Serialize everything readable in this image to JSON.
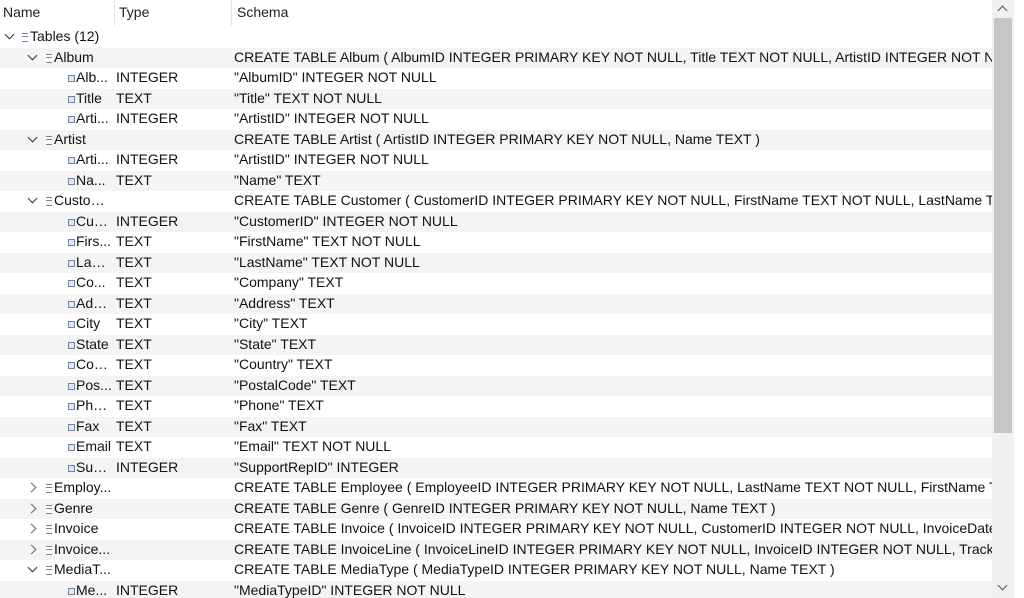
{
  "columns": {
    "name": "Name",
    "type": "Type",
    "schema": "Schema"
  },
  "rows": [
    {
      "depth": 0,
      "kind": "folder",
      "expanded": true,
      "name": "Tables (12)",
      "type": "",
      "schema": ""
    },
    {
      "depth": 1,
      "kind": "table",
      "expanded": true,
      "name": "Album",
      "type": "",
      "schema": "CREATE TABLE Album ( AlbumID INTEGER PRIMARY KEY NOT NULL, Title TEXT NOT NULL, ArtistID INTEGER NOT NULL, FOREIGN"
    },
    {
      "depth": 2,
      "kind": "field",
      "name": "Alb...",
      "type": "INTEGER",
      "schema": "\"AlbumID\" INTEGER NOT NULL"
    },
    {
      "depth": 2,
      "kind": "field",
      "name": "Title",
      "type": "TEXT",
      "schema": "\"Title\" TEXT NOT NULL"
    },
    {
      "depth": 2,
      "kind": "field",
      "name": "Arti...",
      "type": "INTEGER",
      "schema": "\"ArtistID\" INTEGER NOT NULL"
    },
    {
      "depth": 1,
      "kind": "table",
      "expanded": true,
      "name": "Artist",
      "type": "",
      "schema": "CREATE TABLE Artist ( ArtistID INTEGER PRIMARY KEY NOT NULL, Name TEXT )"
    },
    {
      "depth": 2,
      "kind": "field",
      "name": "Arti...",
      "type": "INTEGER",
      "schema": "\"ArtistID\" INTEGER NOT NULL"
    },
    {
      "depth": 2,
      "kind": "field",
      "name": "Na...",
      "type": "TEXT",
      "schema": "\"Name\" TEXT"
    },
    {
      "depth": 1,
      "kind": "table",
      "expanded": true,
      "name": "Custom...",
      "type": "",
      "schema": "CREATE TABLE Customer ( CustomerID INTEGER PRIMARY KEY NOT NULL, FirstName TEXT NOT NULL, LastName TEXT NOT NULL"
    },
    {
      "depth": 2,
      "kind": "field",
      "name": "Cus...",
      "type": "INTEGER",
      "schema": "\"CustomerID\" INTEGER NOT NULL"
    },
    {
      "depth": 2,
      "kind": "field",
      "name": "Firs...",
      "type": "TEXT",
      "schema": "\"FirstName\" TEXT NOT NULL"
    },
    {
      "depth": 2,
      "kind": "field",
      "name": "Last...",
      "type": "TEXT",
      "schema": "\"LastName\" TEXT NOT NULL"
    },
    {
      "depth": 2,
      "kind": "field",
      "name": "Co...",
      "type": "TEXT",
      "schema": "\"Company\" TEXT"
    },
    {
      "depth": 2,
      "kind": "field",
      "name": "Add...",
      "type": "TEXT",
      "schema": "\"Address\" TEXT"
    },
    {
      "depth": 2,
      "kind": "field",
      "name": "City",
      "type": "TEXT",
      "schema": "\"City\" TEXT"
    },
    {
      "depth": 2,
      "kind": "field",
      "name": "State",
      "type": "TEXT",
      "schema": "\"State\" TEXT"
    },
    {
      "depth": 2,
      "kind": "field",
      "name": "Cou...",
      "type": "TEXT",
      "schema": "\"Country\" TEXT"
    },
    {
      "depth": 2,
      "kind": "field",
      "name": "Pos...",
      "type": "TEXT",
      "schema": "\"PostalCode\" TEXT"
    },
    {
      "depth": 2,
      "kind": "field",
      "name": "Pho...",
      "type": "TEXT",
      "schema": "\"Phone\" TEXT"
    },
    {
      "depth": 2,
      "kind": "field",
      "name": "Fax",
      "type": "TEXT",
      "schema": "\"Fax\" TEXT"
    },
    {
      "depth": 2,
      "kind": "field",
      "name": "Email",
      "type": "TEXT",
      "schema": "\"Email\" TEXT NOT NULL"
    },
    {
      "depth": 2,
      "kind": "field",
      "name": "Sup...",
      "type": "INTEGER",
      "schema": "\"SupportRepID\" INTEGER"
    },
    {
      "depth": 1,
      "kind": "table",
      "expanded": false,
      "name": "Employ...",
      "type": "",
      "schema": "CREATE TABLE Employee ( EmployeeID INTEGER PRIMARY KEY NOT NULL, LastName TEXT NOT NULL, FirstName TEXT NOT NULL"
    },
    {
      "depth": 1,
      "kind": "table",
      "expanded": false,
      "name": "Genre",
      "type": "",
      "schema": "CREATE TABLE Genre ( GenreID INTEGER PRIMARY KEY NOT NULL, Name TEXT )"
    },
    {
      "depth": 1,
      "kind": "table",
      "expanded": false,
      "name": "Invoice",
      "type": "",
      "schema": "CREATE TABLE Invoice ( InvoiceID INTEGER PRIMARY KEY NOT NULL, CustomerID INTEGER NOT NULL, InvoiceDate DATE NOT"
    },
    {
      "depth": 1,
      "kind": "table",
      "expanded": false,
      "name": "Invoice...",
      "type": "",
      "schema": "CREATE TABLE InvoiceLine ( InvoiceLineID INTEGER PRIMARY KEY NOT NULL, InvoiceID INTEGER NOT NULL, TrackID INTEGER"
    },
    {
      "depth": 1,
      "kind": "table",
      "expanded": true,
      "name": "MediaT...",
      "type": "",
      "schema": "CREATE TABLE MediaType ( MediaTypeID INTEGER PRIMARY KEY NOT NULL, Name TEXT )"
    },
    {
      "depth": 2,
      "kind": "field",
      "name": "Me...",
      "type": "INTEGER",
      "schema": "\"MediaTypeID\" INTEGER NOT NULL"
    }
  ]
}
